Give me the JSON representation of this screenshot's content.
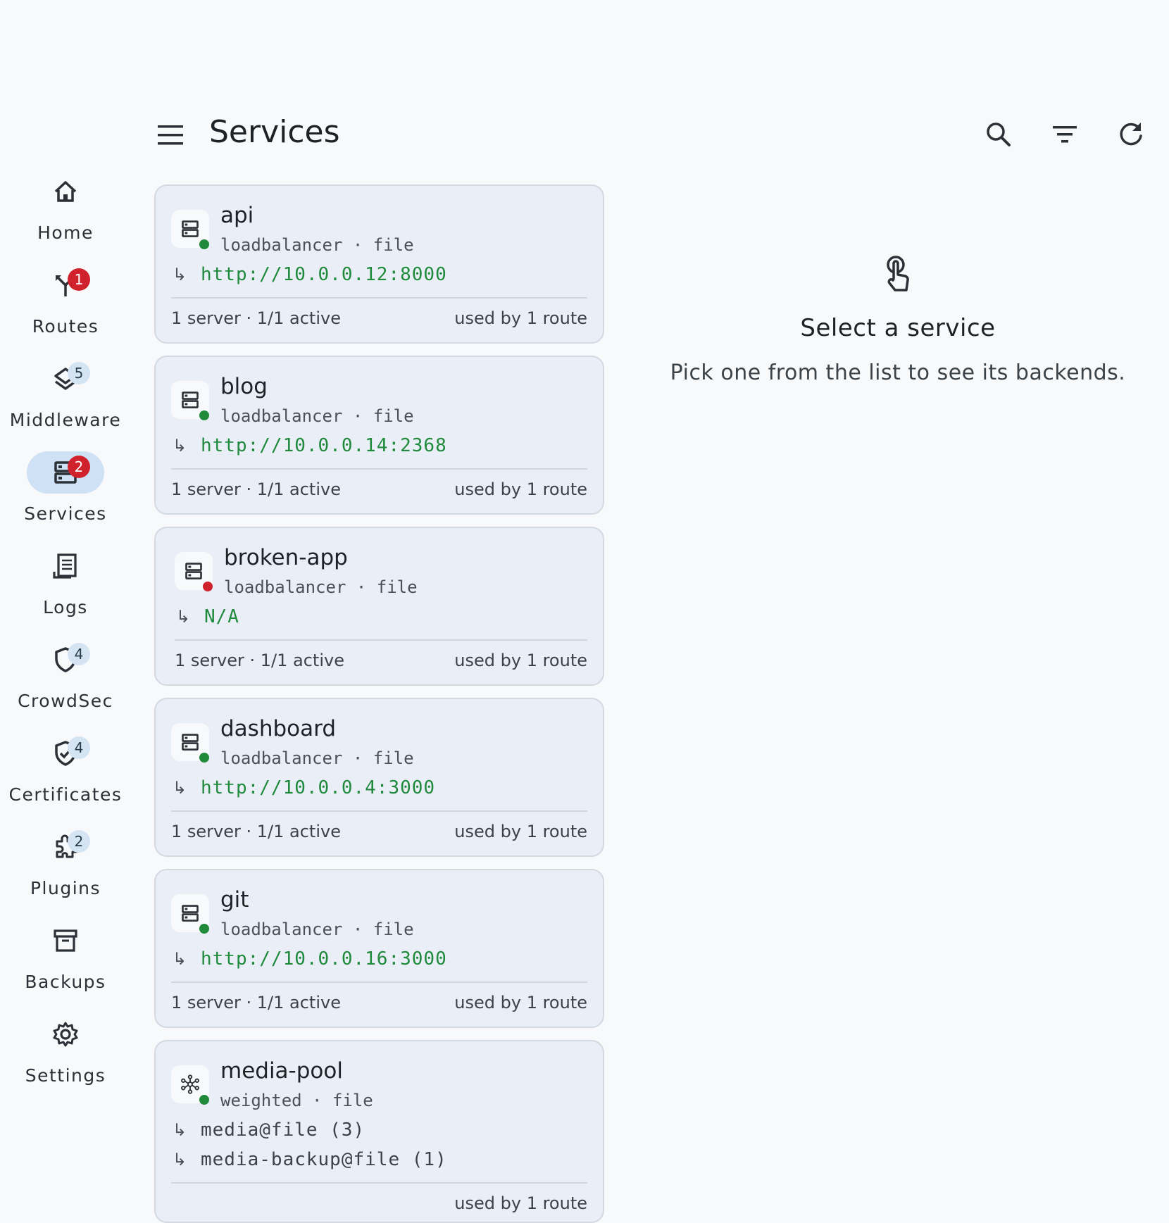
{
  "header": {
    "title": "Services",
    "menu_icon": "menu-icon",
    "actions": [
      {
        "icon": "search-icon"
      },
      {
        "icon": "filter-icon"
      },
      {
        "icon": "refresh-icon"
      }
    ]
  },
  "nav": {
    "items": [
      {
        "label": "Home",
        "icon": "home-icon",
        "badge": ""
      },
      {
        "label": "Routes",
        "icon": "routes-icon",
        "badge": "1",
        "badge_color": "#d0222c"
      },
      {
        "label": "Middleware",
        "icon": "layers-icon",
        "badge": "5"
      },
      {
        "label": "Services",
        "icon": "server-icon",
        "badge": "2",
        "badge_color": "#d0222c",
        "active": true
      },
      {
        "label": "Logs",
        "icon": "logs-icon",
        "badge": ""
      },
      {
        "label": "CrowdSec",
        "icon": "shield-icon",
        "badge": "4"
      },
      {
        "label": "Certificates",
        "icon": "certificate-shield-icon",
        "badge": "4"
      },
      {
        "label": "Plugins",
        "icon": "puzzle-icon",
        "badge": "2"
      },
      {
        "label": "Backups",
        "icon": "archive-icon",
        "badge": ""
      },
      {
        "label": "Settings",
        "icon": "gear-icon",
        "badge": ""
      }
    ]
  },
  "services": [
    {
      "name": "api",
      "meta": "loadbalancer · file",
      "status": "ok",
      "icon": "server-icon",
      "targets": [
        {
          "text": "http://10.0.0.12:8000",
          "style": "green"
        }
      ],
      "servers": "1 server · 1/1 active",
      "used_by": "used by 1 route"
    },
    {
      "name": "blog",
      "meta": "loadbalancer · file",
      "status": "ok",
      "icon": "server-icon",
      "targets": [
        {
          "text": "http://10.0.0.14:2368",
          "style": "green"
        }
      ],
      "servers": "1 server · 1/1 active",
      "used_by": "used by 1 route"
    },
    {
      "name": "broken-app",
      "meta": "loadbalancer · file",
      "status": "err",
      "icon": "server-icon",
      "targets": [
        {
          "text": "N/A",
          "style": "green"
        }
      ],
      "servers": "1 server · 1/1 active",
      "used_by": "used by 1 route"
    },
    {
      "name": "dashboard",
      "meta": "loadbalancer · file",
      "status": "ok",
      "icon": "server-icon",
      "targets": [
        {
          "text": "http://10.0.0.4:3000",
          "style": "green"
        }
      ],
      "servers": "1 server · 1/1 active",
      "used_by": "used by 1 route"
    },
    {
      "name": "git",
      "meta": "loadbalancer · file",
      "status": "ok",
      "icon": "server-icon",
      "targets": [
        {
          "text": "http://10.0.0.16:3000",
          "style": "green"
        }
      ],
      "servers": "1 server · 1/1 active",
      "used_by": "used by 1 route"
    },
    {
      "name": "media-pool",
      "meta": "weighted · file",
      "status": "ok",
      "icon": "hub-icon",
      "targets": [
        {
          "text": "media@file (3)",
          "style": "plain"
        },
        {
          "text": "media-backup@file (1)",
          "style": "plain"
        }
      ],
      "servers": "",
      "used_by": "used by 1 route"
    }
  ],
  "empty_state": {
    "icon": "touch-icon",
    "title": "Select a service",
    "subtitle": "Pick one from the list to see its backends."
  },
  "colors": {
    "status_ok": "#1e8a3a",
    "status_err": "#d0222c",
    "url_green": "#1f8a3c",
    "active_pill": "#cfe1f4"
  }
}
